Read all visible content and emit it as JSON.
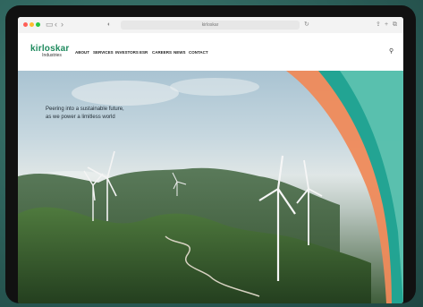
{
  "browser": {
    "url": "kirloskar",
    "colors": {
      "close": "#ff5f57",
      "minimize": "#febc2e",
      "zoom": "#28c840"
    }
  },
  "site": {
    "logo_main": "kirloskar",
    "logo_sub": "Industries",
    "nav": [
      "ABOUT",
      "SERVICES",
      "INVESTORS",
      "ESR",
      "CAREERS",
      "NEWS",
      "CONTACT"
    ]
  },
  "hero": {
    "tagline_line1": "Peering into a sustainable future,",
    "tagline_line2": "as we power a limitless world"
  },
  "colors": {
    "brand_green": "#1f8a5e",
    "teal_swoosh": "#17a596",
    "orange_swoosh": "#ef8a5a"
  }
}
